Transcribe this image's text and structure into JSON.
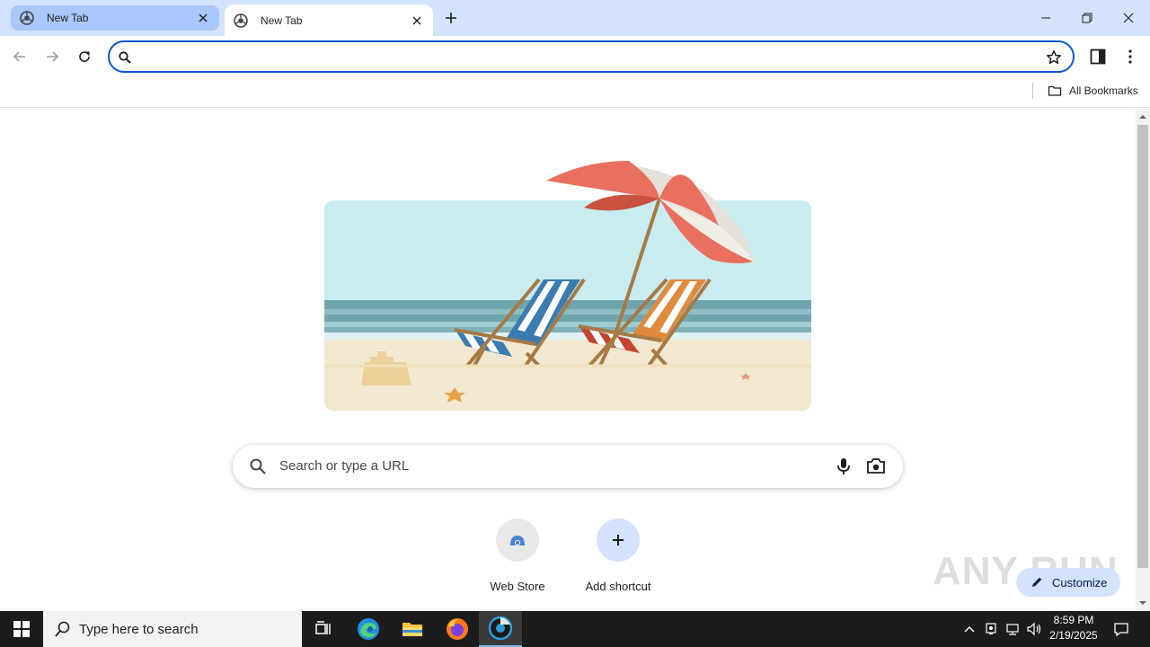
{
  "tabs": [
    {
      "title": "New Tab",
      "active": false
    },
    {
      "title": "New Tab",
      "active": true
    }
  ],
  "omnibox": {
    "value": "",
    "placeholder": ""
  },
  "bookmarks": {
    "all_label": "All Bookmarks"
  },
  "ntp": {
    "search_placeholder": "Search or type a URL",
    "shortcuts": [
      {
        "label": "Web Store",
        "icon": "web-store-icon"
      },
      {
        "label": "Add shortcut",
        "icon": "plus-icon"
      }
    ],
    "customize_label": "Customize",
    "watermark": "ANY RUN"
  },
  "taskbar": {
    "search_text": "Type here to search",
    "time": "8:59 PM",
    "date": "2/19/2025",
    "apps": [
      "task-view-icon",
      "edge-icon",
      "file-explorer-icon",
      "firefox-icon",
      "chrome-icon"
    ]
  },
  "colors": {
    "tabstrip": "#d3e3fd",
    "inactive_tab": "#a8c7fa",
    "omnibox_focus": "#0b57d0",
    "taskbar": "#1c1c1c"
  }
}
